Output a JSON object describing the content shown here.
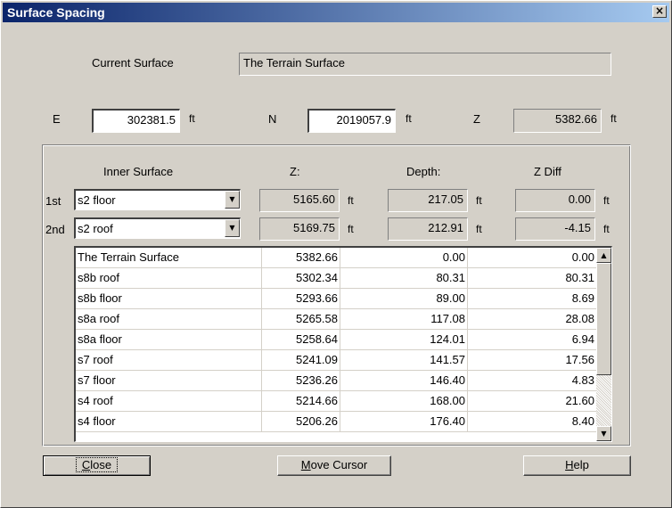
{
  "window": {
    "title": "Surface Spacing",
    "close_label": "×"
  },
  "current_surface": {
    "label": "Current Surface",
    "value": "The Terrain Surface"
  },
  "coords": {
    "e_label": "E",
    "e_value": "302381.5",
    "e_unit": "ft",
    "n_label": "N",
    "n_value": "2019057.9",
    "n_unit": "ft",
    "z_label": "Z",
    "z_value": "5382.66",
    "z_unit": "ft"
  },
  "headers": {
    "inner_surface": "Inner Surface",
    "z": "Z:",
    "depth": "Depth:",
    "zdiff": "Z Diff"
  },
  "first": {
    "label": "1st",
    "surface": "s2 floor",
    "z": "5165.60",
    "depth": "217.05",
    "zdiff": "0.00",
    "unit": "ft"
  },
  "second": {
    "label": "2nd",
    "surface": "s2 roof",
    "z": "5169.75",
    "depth": "212.91",
    "zdiff": "-4.15",
    "unit": "ft"
  },
  "table": {
    "rows": [
      {
        "name": "The Terrain Surface",
        "z": "5382.66",
        "depth": "0.00",
        "zdiff": "0.00"
      },
      {
        "name": "s8b roof",
        "z": "5302.34",
        "depth": "80.31",
        "zdiff": "80.31"
      },
      {
        "name": "s8b floor",
        "z": "5293.66",
        "depth": "89.00",
        "zdiff": "8.69"
      },
      {
        "name": "s8a roof",
        "z": "5265.58",
        "depth": "117.08",
        "zdiff": "28.08"
      },
      {
        "name": "s8a floor",
        "z": "5258.64",
        "depth": "124.01",
        "zdiff": "6.94"
      },
      {
        "name": "s7 roof",
        "z": "5241.09",
        "depth": "141.57",
        "zdiff": "17.56"
      },
      {
        "name": "s7 floor",
        "z": "5236.26",
        "depth": "146.40",
        "zdiff": "4.83"
      },
      {
        "name": "s4 roof",
        "z": "5214.66",
        "depth": "168.00",
        "zdiff": "21.60"
      },
      {
        "name": "s4 floor",
        "z": "5206.26",
        "depth": "176.40",
        "zdiff": "8.40"
      }
    ]
  },
  "buttons": {
    "close_key": "C",
    "close_rest": "lose",
    "move_key": "M",
    "move_rest": "ove Cursor",
    "help_key": "H",
    "help_rest": "elp"
  },
  "icons": {
    "scroll_up": "up-arrow-icon",
    "scroll_down": "down-arrow-icon",
    "combo": "dropdown-arrow-icon"
  }
}
